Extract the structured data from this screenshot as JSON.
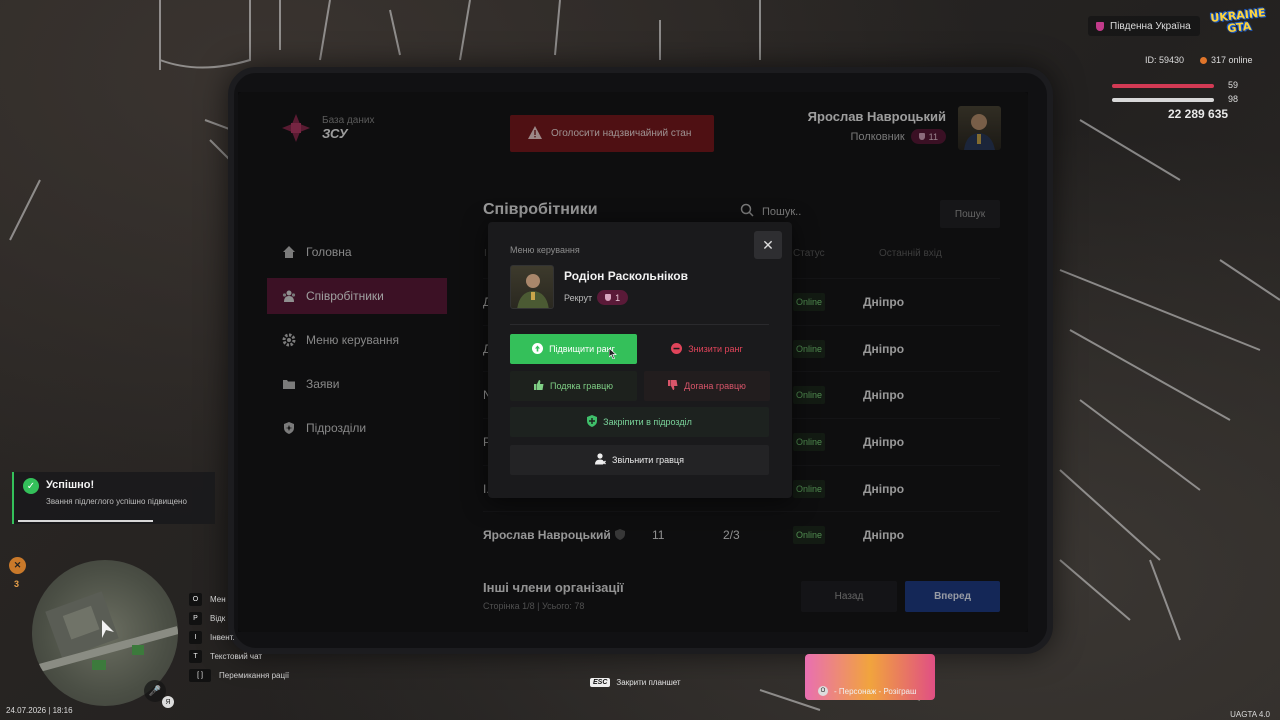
{
  "hud": {
    "region": "Південна Україна",
    "game_logo": "UKRAINE GTA",
    "player_id": "ID: 59430",
    "online": "317 online",
    "health": "59",
    "armor": "98",
    "money": "22 289 635",
    "datetime": "24.07.2026 | 18:16",
    "version": "UAGTA 4.0",
    "level": "3",
    "mic_key": "Я",
    "keybinds": [
      {
        "key": "O",
        "label": "Мен"
      },
      {
        "key": "P",
        "label": "Відк"
      },
      {
        "key": "I",
        "label": "Інвент."
      },
      {
        "key": "T",
        "label": "Текстовий чат"
      },
      {
        "key": "[ ]",
        "label": "Перемикання рації"
      }
    ],
    "esc_hint": {
      "key": "ESC",
      "label": "Закрити планшет"
    },
    "promo": {
      "key": "O",
      "label": "- Персонаж - Розіграш"
    }
  },
  "tablet": {
    "brand_sub": "База даних",
    "brand_title": "ЗСУ",
    "emergency_label": "Оголосити надзвичайний стан",
    "user_name": "Ярослав Навроцький",
    "user_rank": "Полковник",
    "user_rank_level": "11",
    "nav": [
      {
        "label": "Головна",
        "icon": "home-icon"
      },
      {
        "label": "Співробітники",
        "icon": "users-icon",
        "active": true
      },
      {
        "label": "Меню керування",
        "icon": "gear-icon"
      },
      {
        "label": "Заяви",
        "icon": "folder-icon"
      },
      {
        "label": "Підрозділи",
        "icon": "shield-icon"
      }
    ],
    "list_title": "Співробітники",
    "search_placeholder": "Пошук..",
    "search_button": "Пошук",
    "columns": {
      "name": "І",
      "status": "Статус",
      "last_login": "Останній вхід"
    },
    "rows": [
      {
        "name": "Д",
        "status": "Online",
        "city": "Дніпро"
      },
      {
        "name": "Д",
        "status": "Online",
        "city": "Дніпро"
      },
      {
        "name": "N",
        "status": "Online",
        "city": "Дніпро"
      },
      {
        "name": "P",
        "status": "Online",
        "city": "Дніпро"
      },
      {
        "name": "I.",
        "status": "Online",
        "city": "Дніпро"
      },
      {
        "name": "Ярослав Навроцький",
        "rank": "11",
        "units": "2/3",
        "status": "Online",
        "city": "Дніпро"
      }
    ],
    "others_title": "Інші члени організації",
    "page_info": "Сторінка 1/8 | Усього: 78",
    "back_button": "Назад",
    "next_button": "Вперед"
  },
  "modal": {
    "label": "Меню керування",
    "name": "Родіон Раскольніков",
    "rank": "Рекрут",
    "rank_level": "1",
    "promote": "Підвищити ранг",
    "demote": "Знизити ранг",
    "thanks": "Подяка гравцю",
    "reprimand": "Догана гравцю",
    "assign": "Закріпити в підрозділ",
    "fire": "Звільнити гравця"
  },
  "toast": {
    "title": "Успішно!",
    "text": "Звання підлеглого успішно підвищено",
    "progress": 0.68
  },
  "colors": {
    "accent": "#5c1b3a",
    "success": "#34c05a",
    "danger": "#e0445a",
    "primary": "#1f3d86",
    "emergency": "#7a1a1e"
  }
}
